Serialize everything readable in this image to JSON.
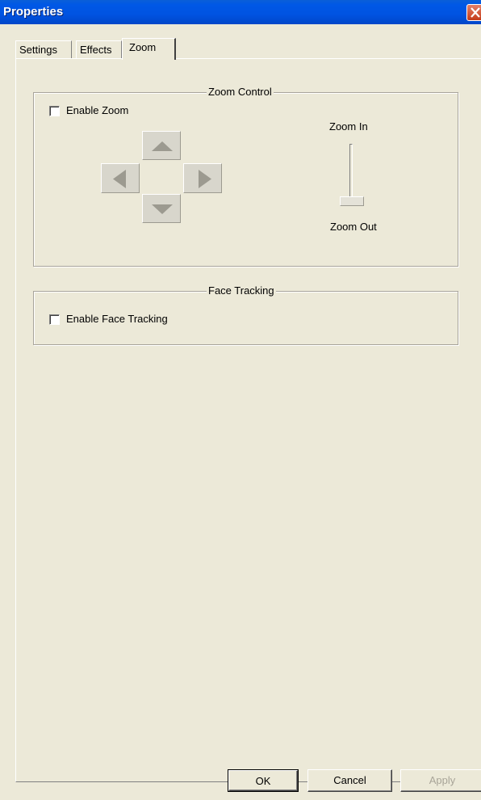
{
  "window": {
    "title": "Properties"
  },
  "tabs": [
    {
      "label": "Settings",
      "active": false
    },
    {
      "label": "Effects",
      "active": false
    },
    {
      "label": "Zoom",
      "active": true
    }
  ],
  "zoom_control": {
    "group_label": "Zoom Control",
    "enable_label": "Enable Zoom",
    "enabled": false,
    "zoom_in_label": "Zoom In",
    "zoom_out_label": "Zoom Out",
    "zoom_level": 0
  },
  "face_tracking": {
    "group_label": "Face Tracking",
    "enable_label": "Enable Face Tracking",
    "enabled": false
  },
  "buttons": {
    "ok": "OK",
    "cancel": "Cancel",
    "apply": "Apply"
  },
  "icons": {
    "close": "close-icon",
    "pan_up": "arrow-up-icon",
    "pan_down": "arrow-down-icon",
    "pan_left": "arrow-left-icon",
    "pan_right": "arrow-right-icon"
  },
  "colors": {
    "titlebar": "#0053e1",
    "dialog_bg": "#ece9d8",
    "close_button": "#c43b1a",
    "disabled_text": "#a8a498"
  }
}
